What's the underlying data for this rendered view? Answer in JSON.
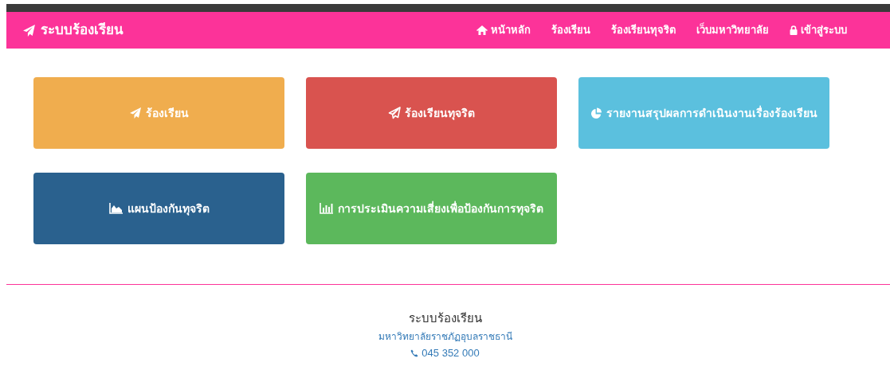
{
  "navbar": {
    "brand": "ระบบร้องเรียน",
    "links": [
      "หน้าหลัก",
      "ร้องเรียน",
      "ร้องเรียนทุจริต",
      "เว็บมหาวิทยาลัย",
      "เข้าสู่ระบบ"
    ]
  },
  "tiles": [
    {
      "label": "ร้องเรียน",
      "color": "#f0ad4e"
    },
    {
      "label": "ร้องเรียนทุจริต",
      "color": "#d9534f"
    },
    {
      "label": "รายงานสรุปผลการดำเนินงานเรื่องร้องเรียน",
      "color": "#5bc0de"
    },
    {
      "label": "แผนป้องกันทุจริต",
      "color": "#2a618e"
    },
    {
      "label": "การประเมินความเสี่ยงเพื่อป้องกันการทุจริต",
      "color": "#5cb85c"
    }
  ],
  "footer": {
    "title": "ระบบร้องเรียน",
    "university": "มหาวิทยาลัยราชภัฏอุบลราชธานี",
    "phone": "045 352 000"
  }
}
